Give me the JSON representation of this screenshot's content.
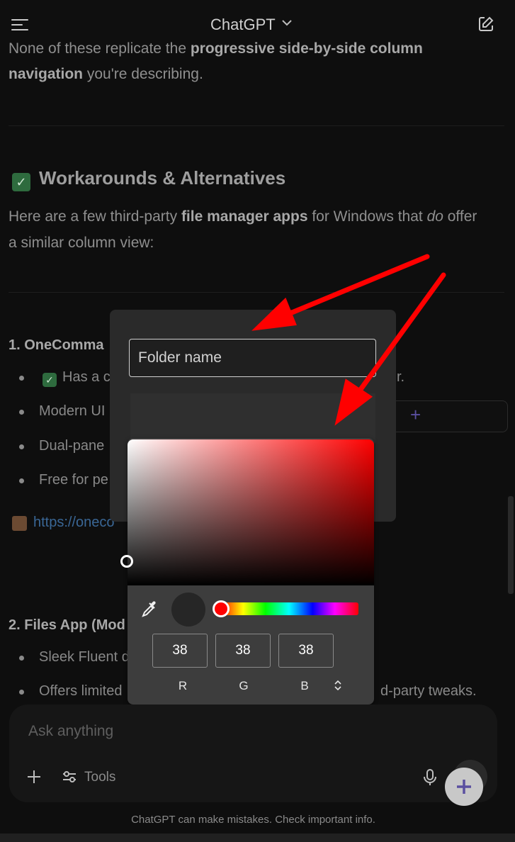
{
  "header": {
    "title": "ChatGPT"
  },
  "chat": {
    "line1_pre": "None of these replicate the ",
    "line1_bold": "progressive side-by-side column",
    "line2_bold": "navigation",
    "line2_post": " you're describing.",
    "heading": "Workarounds & Alternatives",
    "para_1": "Here are a few third-party ",
    "para_bold": "file manager apps",
    "para_2": " for Windows that ",
    "para_em": "do",
    "para_3": " offer",
    "para_line2": "a similar column view:",
    "section1": "1. OneComma",
    "s1_items": [
      "Has a c",
      "Modern UI",
      "Dual-pane",
      "Free for pe"
    ],
    "s1_item1_tail": "r.",
    "link": "https://oneco",
    "section2": "2. Files App (Mod",
    "s2_items": [
      "Sleek Fluent d",
      "Offers limited"
    ],
    "s2_item2_tail": "d-party tweaks.",
    "side_button": "er"
  },
  "dialog": {
    "folder_placeholder": "Folder name"
  },
  "picker": {
    "r": "38",
    "g": "38",
    "b": "38",
    "label_r": "R",
    "label_g": "G",
    "label_b": "B",
    "hue_color": "#ff0000",
    "preview_color": "#262626"
  },
  "composer": {
    "placeholder": "Ask anything",
    "tools_label": "Tools"
  },
  "footer": {
    "text": "ChatGPT can make mistakes. Check important info."
  }
}
